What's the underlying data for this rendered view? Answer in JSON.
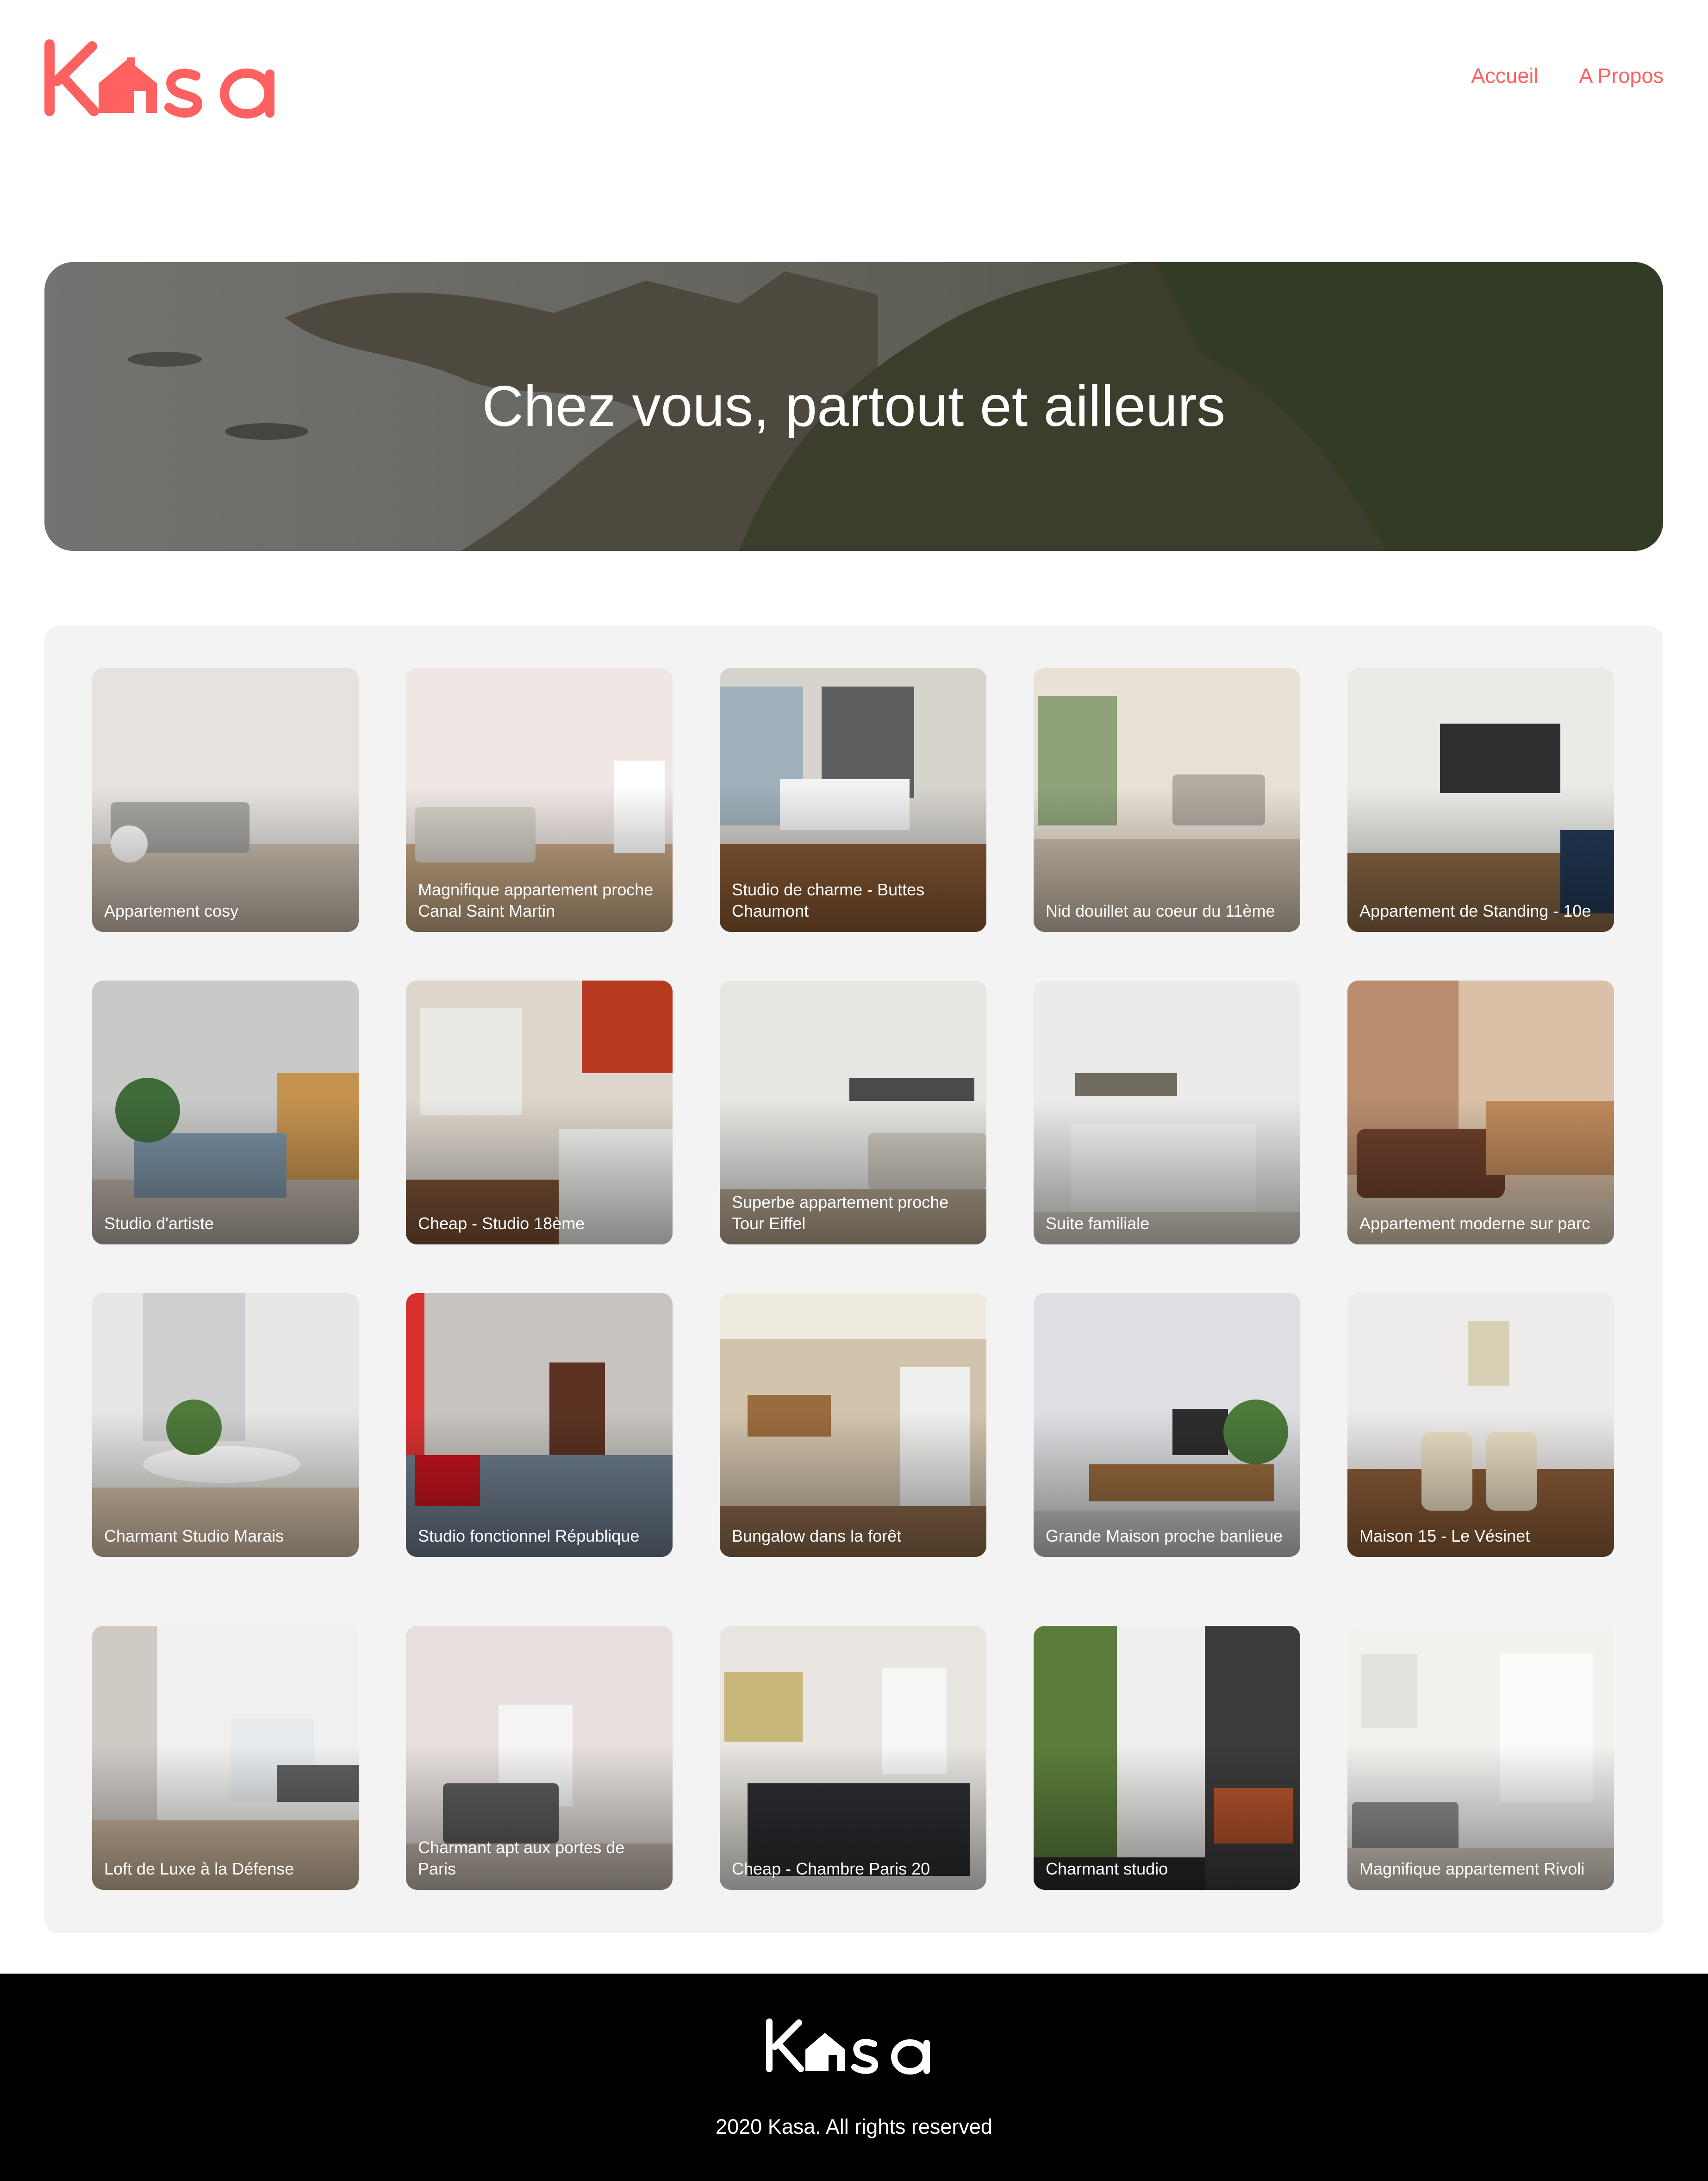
{
  "header": {
    "logo_alt": "Kasa",
    "brand_color": "#FF6060",
    "nav": [
      {
        "label": "Accueil"
      },
      {
        "label": "A Propos"
      }
    ]
  },
  "banner": {
    "title": "Chez vous, partout et ailleurs"
  },
  "listings": [
    {
      "title": "Appartement cosy"
    },
    {
      "title": "Magnifique appartement proche Canal Saint Martin"
    },
    {
      "title": "Studio de charme - Buttes Chaumont"
    },
    {
      "title": "Nid douillet au coeur du 11ème"
    },
    {
      "title": "Appartement de Standing - 10e"
    },
    {
      "title": "Studio d'artiste"
    },
    {
      "title": "Cheap - Studio 18ème"
    },
    {
      "title": "Superbe appartement proche Tour Eiffel"
    },
    {
      "title": "Suite familiale"
    },
    {
      "title": "Appartement moderne sur parc"
    },
    {
      "title": "Charmant Studio Marais"
    },
    {
      "title": "Studio fonctionnel République"
    },
    {
      "title": "Bungalow dans la forêt"
    },
    {
      "title": "Grande Maison proche banlieue"
    },
    {
      "title": "Maison 15 - Le Vésinet"
    },
    {
      "title": "Loft de Luxe à la Défense"
    },
    {
      "title": "Charmant apt aux portes de Paris"
    },
    {
      "title": "Cheap - Chambre Paris 20"
    },
    {
      "title": "Charmant studio"
    },
    {
      "title": "Magnifique appartement Rivoli"
    }
  ],
  "footer": {
    "logo_alt": "Kasa",
    "copyright": "2020 Kasa. All rights reserved"
  }
}
